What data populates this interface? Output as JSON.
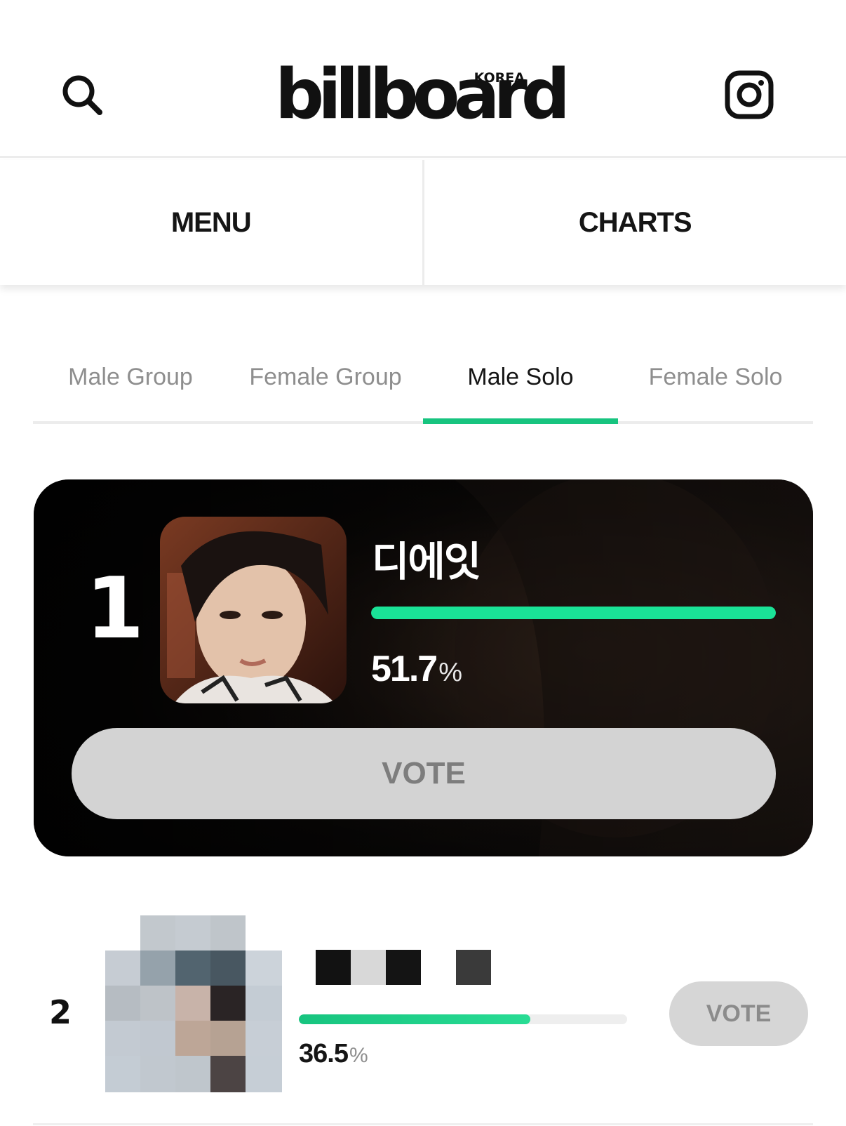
{
  "header": {
    "logo_main": "billboard",
    "logo_sub": "KOREA",
    "search_icon": "search-icon",
    "instagram_icon": "instagram-icon"
  },
  "nav": {
    "menu_label": "MENU",
    "charts_label": "CHARTS"
  },
  "tabs": [
    {
      "label": "Male Group",
      "active": false
    },
    {
      "label": "Female Group",
      "active": false
    },
    {
      "label": "Male Solo",
      "active": true
    },
    {
      "label": "Female Solo",
      "active": false
    }
  ],
  "ranking": [
    {
      "rank": "1",
      "name": "디에잇",
      "percent": "51.7",
      "unit": "%",
      "progress": 1.0,
      "vote_label": "VOTE"
    },
    {
      "rank": "2",
      "name": "",
      "percent": "36.5",
      "unit": "%",
      "progress": 0.706,
      "vote_label": "VOTE"
    }
  ],
  "colors": {
    "accent": "#17c47f",
    "bar_bright": "#1ae397",
    "vote_bg": "#d3d3d3"
  }
}
